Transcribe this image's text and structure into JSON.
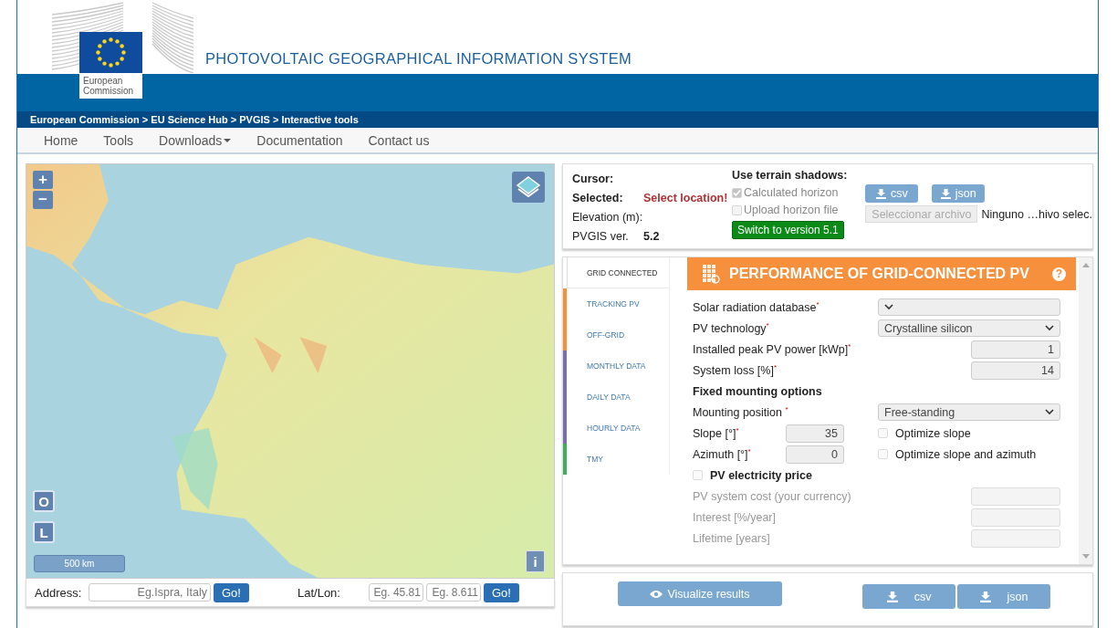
{
  "header": {
    "logo_text": "European Commission",
    "title": "PHOTOVOLTAIC GEOGRAPHICAL INFORMATION SYSTEM",
    "breadcrumb": "European Commission > EU Science Hub > PVGIS > Interactive tools"
  },
  "nav": [
    {
      "label": "Home",
      "dropdown": false
    },
    {
      "label": "Tools",
      "dropdown": false
    },
    {
      "label": "Downloads",
      "dropdown": true
    },
    {
      "label": "Documentation",
      "dropdown": false
    },
    {
      "label": "Contact us",
      "dropdown": false
    }
  ],
  "map": {
    "zoom_in": "+",
    "zoom_out": "−",
    "button_o": "O",
    "button_l": "L",
    "scale": "500 km",
    "info": "i"
  },
  "search": {
    "address_label": "Address:",
    "address_placeholder": "Eg.Ispra, Italy",
    "go": "Go!",
    "latlon_label": "Lat/Lon:",
    "lat_placeholder": "Eg. 45.81",
    "lon_placeholder": "Eg. 8.611",
    "go2": "Go!"
  },
  "info": {
    "cursor_label": "Cursor:",
    "selected_label": "Selected:",
    "selected_value": "Select location!",
    "elevation_label": "Elevation (m):",
    "version_label": "PVGIS ver.",
    "version_value": "5.2",
    "terrain_title": "Use terrain shadows:",
    "terrain_options": [
      {
        "label": "Calculated horizon",
        "checked": true,
        "disabled": true
      },
      {
        "label": "Upload horizon file",
        "checked": false,
        "disabled": true
      }
    ],
    "switch_button": "Switch to version 5.1",
    "csv": "csv",
    "json": "json",
    "file_button": "Seleccionar archivo",
    "file_status": "Ninguno …hivo selec."
  },
  "tabs": [
    {
      "label": "GRID CONNECTED",
      "selected": true,
      "color": "#ffffff"
    },
    {
      "label": "TRACKING PV",
      "selected": false,
      "color": "#f7903c"
    },
    {
      "label": "OFF-GRID",
      "selected": false,
      "color": "#f7903c"
    },
    {
      "label": "MONTHLY DATA",
      "selected": false,
      "color": "#7a6db3"
    },
    {
      "label": "DAILY DATA",
      "selected": false,
      "color": "#7a6db3"
    },
    {
      "label": "HOURLY DATA",
      "selected": false,
      "color": "#7a6db3"
    },
    {
      "label": "TMY",
      "selected": false,
      "color": "#3fae5a"
    }
  ],
  "panel": {
    "title": "PERFORMANCE OF GRID-CONNECTED PV",
    "help": "?"
  },
  "form": [
    {
      "kind": "select",
      "label": "Solar radiation database$^{*}$"
    },
    {
      "kind": "select",
      "label": "PV technology$^{*}$",
      "value": "Crystalline silicon"
    },
    {
      "kind": "number",
      "label": "Installed peak PV power [kWp]$^{*}$",
      "value": "1",
      "disabled": false
    },
    {
      "kind": "number",
      "label": "System loss [%]$^{*}$",
      "value": "14",
      "disabled": false
    },
    {
      "kind": "heading",
      "label": "Fixed mounting options"
    },
    {
      "kind": "select",
      "label": "Mounting position $^{*}$",
      "value": "Free-standing"
    },
    {
      "kind": "angle",
      "label": "Slope [°]$^{*}$",
      "value": "35",
      "option": {
        "label": "Optimize slope",
        "checked": false
      }
    },
    {
      "kind": "angle",
      "label": "Azimuth [°]$^{*}$",
      "value": "0",
      "option": {
        "label": "Optimize slope and azimuth",
        "checked": false
      }
    },
    {
      "kind": "checkbox",
      "label": "PV electricity price",
      "checked": false
    },
    {
      "kind": "number",
      "label": "PV system cost (your currency)",
      "disabled": true
    },
    {
      "kind": "number",
      "label": "Interest [%/year]",
      "disabled": true
    },
    {
      "kind": "number",
      "label": "Lifetime [years]",
      "disabled": true
    }
  ],
  "actions": {
    "visualize": "Visualize results",
    "csv": "csv",
    "json": "json"
  }
}
